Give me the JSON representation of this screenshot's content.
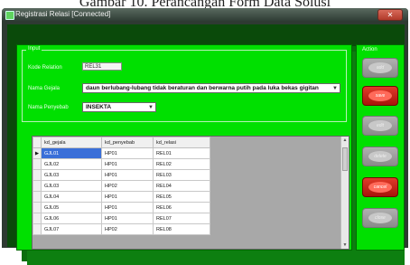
{
  "caption": "Gambar 10. Perancangan Form Data Solusi",
  "window": {
    "title": "Registrasi Relasi [Connected]"
  },
  "input_group": {
    "title": "Input",
    "kode_relasi_label": "Kode Relation",
    "kode_relasi_value": "REL31",
    "nama_gejala_label": "Nama Gejala",
    "nama_gejala_value": "daun berlubang-lubang tidak beraturan dan berwarna putih pada luka bekas gigitan",
    "nama_penyebab_label": "Nama Penyebab",
    "nama_penyebab_value": "INSEKTA"
  },
  "grid": {
    "columns": [
      "kd_gejala",
      "kd_penyebab",
      "kd_relasi"
    ],
    "rows": [
      [
        "GJL01",
        "HP01",
        "REL01"
      ],
      [
        "GJL02",
        "HP01",
        "REL02"
      ],
      [
        "GJL03",
        "HP01",
        "REL03"
      ],
      [
        "GJL03",
        "HP02",
        "REL04"
      ],
      [
        "GJL04",
        "HP01",
        "REL05"
      ],
      [
        "GJL05",
        "HP01",
        "REL06"
      ],
      [
        "GJL06",
        "HP01",
        "REL07"
      ],
      [
        "GJL07",
        "HP02",
        "REL08"
      ]
    ],
    "selected_row": 0,
    "row_indicator": "▶"
  },
  "actions": {
    "title": "Action",
    "buttons": [
      {
        "label": "add",
        "style": "grey"
      },
      {
        "label": "save",
        "style": "red"
      },
      {
        "label": "edit",
        "style": "grey"
      },
      {
        "label": "delete",
        "style": "grey"
      },
      {
        "label": "cancel",
        "style": "red"
      },
      {
        "label": "close",
        "style": "grey"
      }
    ]
  },
  "colors": {
    "panel": "#00e000",
    "shadow": "#0b6d0e",
    "selected": "#3a6fd8",
    "action_red": "#c8281a"
  }
}
